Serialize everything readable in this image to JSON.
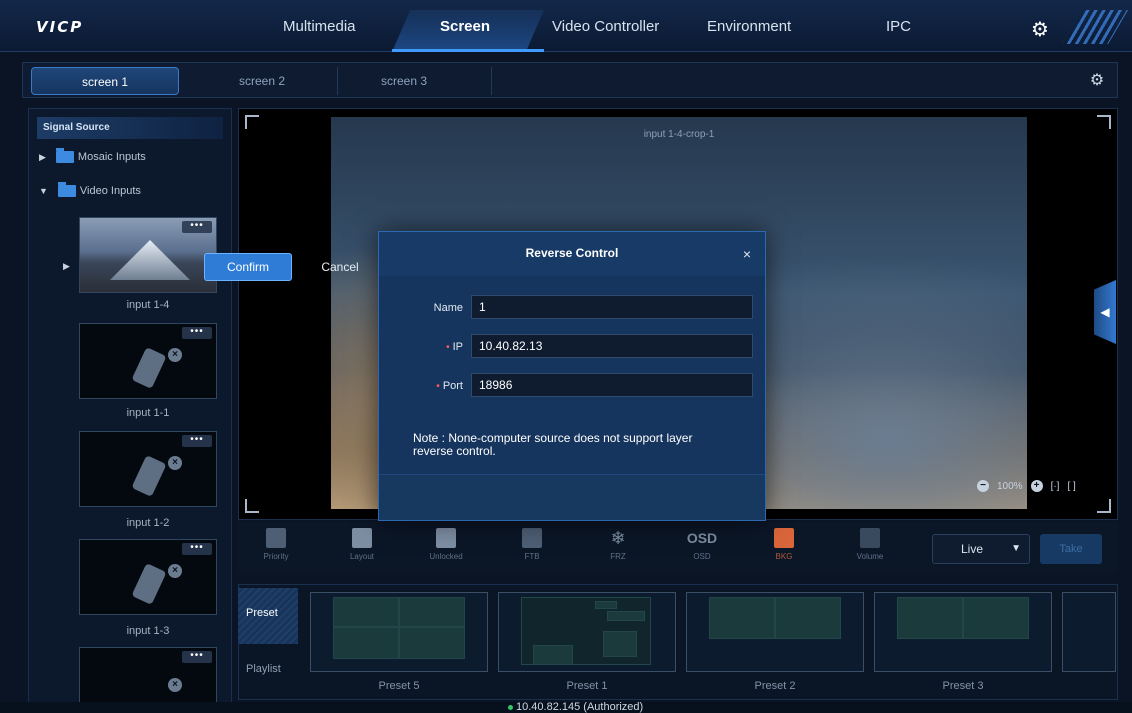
{
  "app": {
    "logo": "VICP"
  },
  "nav": {
    "tabs": [
      "Multimedia",
      "Screen",
      "Video Controller",
      "Environment",
      "IPC"
    ],
    "active": "Screen",
    "settings_icon": "gear-icon"
  },
  "screens": {
    "tabs": [
      "screen 1",
      "screen 2",
      "screen 3"
    ],
    "active": "screen 1"
  },
  "sidebar": {
    "header": "Signal Source",
    "folders": [
      "Mosaic Inputs",
      "Video Inputs"
    ],
    "inputs": [
      {
        "label": "input 1-4",
        "more": "•••"
      },
      {
        "label": "input 1-1",
        "more": "•••"
      },
      {
        "label": "input 1-2",
        "more": "•••"
      },
      {
        "label": "input 1-3",
        "more": "•••"
      },
      {
        "label": "",
        "more": "•••"
      }
    ]
  },
  "preview": {
    "layer_label": "input 1-4-crop-1",
    "zoom": "100%"
  },
  "toolbar": {
    "tools": [
      "Priority",
      "Layout",
      "Unlocked",
      "FTB",
      "FRZ",
      "OSD",
      "BKG",
      "Volume"
    ],
    "osd_glyph": "OSD",
    "mode": "Live",
    "take_label": "Take"
  },
  "presets": {
    "side_tabs": [
      "Preset",
      "Playlist"
    ],
    "items": [
      "Preset 5",
      "Preset 1",
      "Preset 2",
      "Preset 3"
    ]
  },
  "status": {
    "text": "10.40.82.145 (Authorized)"
  },
  "modal": {
    "title": "Reverse Control",
    "close": "×",
    "fields": {
      "name_label": "Name",
      "name_value": "1",
      "ip_label": "IP",
      "ip_value": "10.40.82.13",
      "port_label": "Port",
      "port_value": "18986"
    },
    "note": "Note : None-computer source does not support layer reverse control.",
    "confirm": "Confirm",
    "cancel": "Cancel"
  },
  "colors": {
    "accent": "#2f7cd6",
    "nav_active": "#3f9bff",
    "required": "#ff5a5a",
    "status_ok": "#36c36a"
  }
}
